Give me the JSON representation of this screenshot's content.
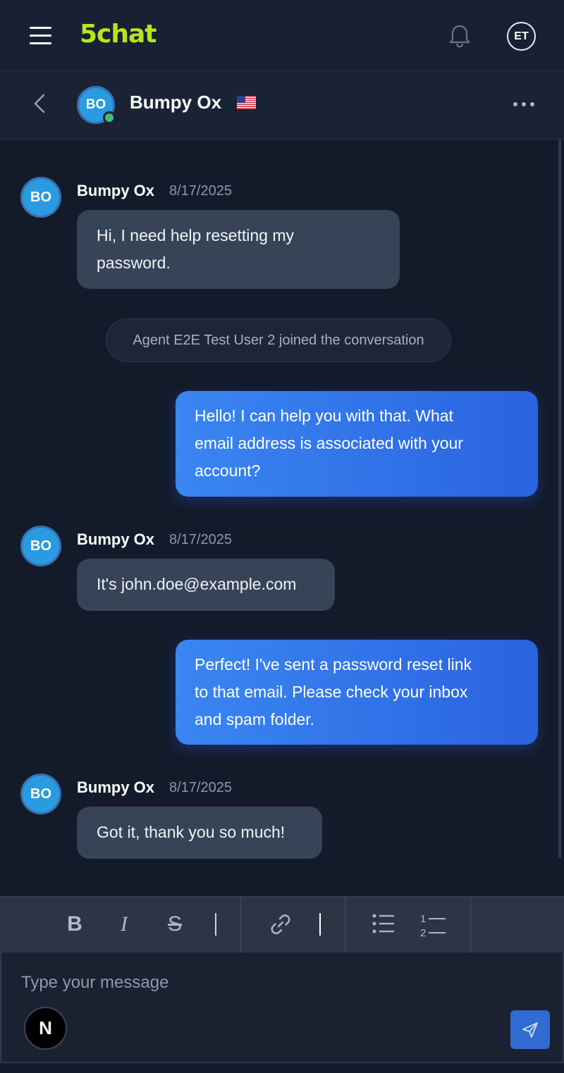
{
  "app": {
    "logo": "5chat",
    "user_initials": "ET"
  },
  "conversation": {
    "contact_name": "Bumpy Ox",
    "contact_initials": "BO"
  },
  "messages": [
    {
      "sender": "Bumpy Ox",
      "initials": "BO",
      "date": "8/17/2025",
      "text_lines": [
        "Hi, I need help resetting my",
        "password."
      ]
    },
    {
      "system": "Agent E2E Test User 2 joined the conversation"
    },
    {
      "outgoing": true,
      "text_lines": [
        "Hello! I can help you with that. What",
        "email address is associated with your",
        "account?"
      ]
    },
    {
      "sender": "Bumpy Ox",
      "initials": "BO",
      "date": "8/17/2025",
      "text_lines": [
        "It's john.doe@example.com"
      ]
    },
    {
      "outgoing": true,
      "text_lines": [
        "Perfect! I've sent a password reset link",
        "to that email. Please check your inbox",
        "and spam folder."
      ]
    },
    {
      "sender": "Bumpy Ox",
      "initials": "BO",
      "date": "8/17/2025",
      "text_lines": [
        "Got it, thank you so much!"
      ]
    }
  ],
  "toolbar": {
    "bold": "B",
    "italic": "I",
    "strike": "S",
    "ordered_one": "1",
    "ordered_two": "2"
  },
  "composer": {
    "placeholder": "Type your message",
    "badge": "N"
  },
  "icons": {
    "menu": "hamburger-icon",
    "bell": "bell-icon",
    "back": "chevron-left-icon",
    "flag": "us-flag-icon",
    "more": "more-horizontal-icon",
    "link": "link-icon",
    "bullets": "bulleted-list-icon",
    "numbers": "numbered-list-icon",
    "send": "send-icon"
  },
  "colors": {
    "accent": "#b6e61e",
    "bubble_out": "#3a86f2",
    "bubble_in": "#374457",
    "avatar": "#2a9be0",
    "online": "#3fbf7a"
  }
}
